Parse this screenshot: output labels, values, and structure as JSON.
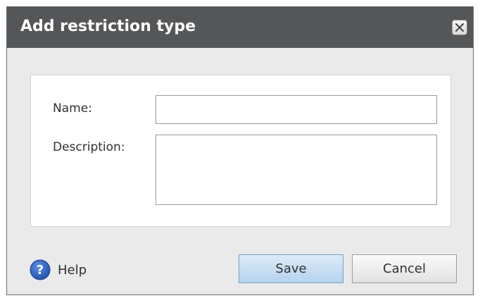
{
  "dialog": {
    "title": "Add restriction type",
    "close_icon": "close-icon"
  },
  "form": {
    "name_label": "Name:",
    "name_value": "",
    "description_label": "Description:",
    "description_value": ""
  },
  "footer": {
    "help_icon": "help-icon",
    "help_label": "Help",
    "save_label": "Save",
    "cancel_label": "Cancel"
  },
  "colors": {
    "titlebar": "#555657",
    "dialog_background": "#eaeaea",
    "help_icon_blue": "#2a64c5",
    "save_button": "#c7ddf3"
  }
}
